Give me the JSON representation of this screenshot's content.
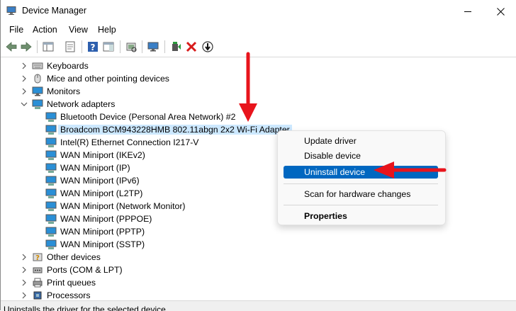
{
  "window": {
    "title": "Device Manager",
    "app_icon": "device-manager-icon",
    "controls": [
      "minimize-icon",
      "maximize-icon",
      "close-icon"
    ]
  },
  "menu": {
    "file": "File",
    "action": "Action",
    "view": "View",
    "help": "Help"
  },
  "toolbar": {
    "buttons": [
      "back-icon",
      "forward-icon",
      "show-hide-console-tree-icon",
      "properties-icon",
      "help-icon",
      "action-pane-icon",
      "scan-hardware-icon",
      "monitor-icon",
      "update-driver-icon",
      "uninstall-icon",
      "disable-device-icon"
    ]
  },
  "tree": {
    "categories_top": [
      {
        "label": "Keyboards",
        "icon": "keyboard-icon"
      },
      {
        "label": "Mice and other pointing devices",
        "icon": "mouse-icon"
      },
      {
        "label": "Monitors",
        "icon": "monitor-icon"
      }
    ],
    "network_adapters": {
      "label": "Network adapters",
      "icon": "network-adapter-icon",
      "children": [
        "Bluetooth Device (Personal Area Network) #2",
        "Broadcom BCM943228HMB 802.11abgn 2x2 Wi-Fi Adapter",
        "Intel(R) Ethernet Connection I217-V",
        "WAN Miniport (IKEv2)",
        "WAN Miniport (IP)",
        "WAN Miniport (IPv6)",
        "WAN Miniport (L2TP)",
        "WAN Miniport (Network Monitor)",
        "WAN Miniport (PPPOE)",
        "WAN Miniport (PPTP)",
        "WAN Miniport (SSTP)"
      ]
    },
    "categories_bottom": [
      {
        "label": "Other devices",
        "icon": "unknown-device-icon"
      },
      {
        "label": "Ports (COM & LPT)",
        "icon": "port-icon"
      },
      {
        "label": "Print queues",
        "icon": "printer-icon"
      },
      {
        "label": "Processors",
        "icon": "processor-icon"
      }
    ]
  },
  "context_menu": {
    "update_driver": "Update driver",
    "disable_device": "Disable device",
    "uninstall_device": "Uninstall device",
    "scan_hardware": "Scan for hardware changes",
    "properties": "Properties"
  },
  "status_bar": {
    "text": "Uninstalls the driver for the selected device."
  },
  "colors": {
    "highlight": "#0067c0",
    "selection": "#cce8ff",
    "annotation_arrow": "#e8141c"
  }
}
